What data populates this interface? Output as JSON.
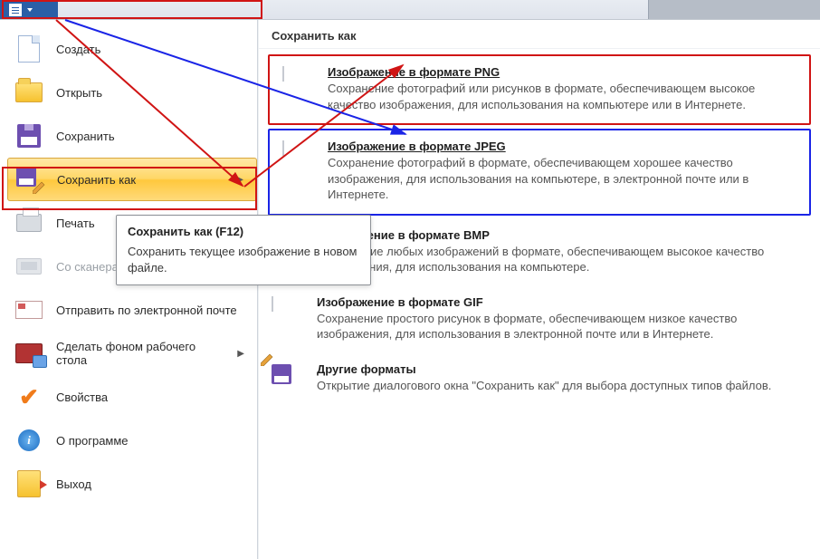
{
  "left_menu": {
    "create": "Создать",
    "open": "Открыть",
    "save": "Сохранить",
    "save_as": "Сохранить как",
    "print": "Печать",
    "scanner": "Со сканера или камеры",
    "send_mail": "Отправить по электронной почте",
    "set_desktop": "Сделать фоном рабочего стола",
    "properties": "Свойства",
    "about": "О программе",
    "exit": "Выход"
  },
  "right": {
    "header": "Сохранить как",
    "png": {
      "title": "Изображение в формате PNG",
      "desc": "Сохранение фотографий или рисунков в формате, обеспечивающем высокое качество изображения, для использования на компьютере или в Интернете."
    },
    "jpeg": {
      "title": "Изображение в формате JPEG",
      "desc": "Сохранение фотографий в формате, обеспечивающем хорошее качество изображения, для использования на компьютере, в электронной почте или в Интернете."
    },
    "bmp": {
      "title": "Изображение в формате BMP",
      "desc": "Сохранение любых изображений в формате, обеспечивающем высокое качество изображения, для использования на компьютере."
    },
    "gif": {
      "title": "Изображение в формате GIF",
      "desc": "Сохранение простого рисунок в формате, обеспечивающем низкое качество изображения, для использования в электронной почте или в Интернете."
    },
    "other": {
      "title": "Другие форматы",
      "desc": "Открытие диалогового окна \"Сохранить как\" для выбора доступных типов файлов."
    }
  },
  "tooltip": {
    "title": "Сохранить как (F12)",
    "body": "Сохранить текущее изображение в новом файле."
  }
}
